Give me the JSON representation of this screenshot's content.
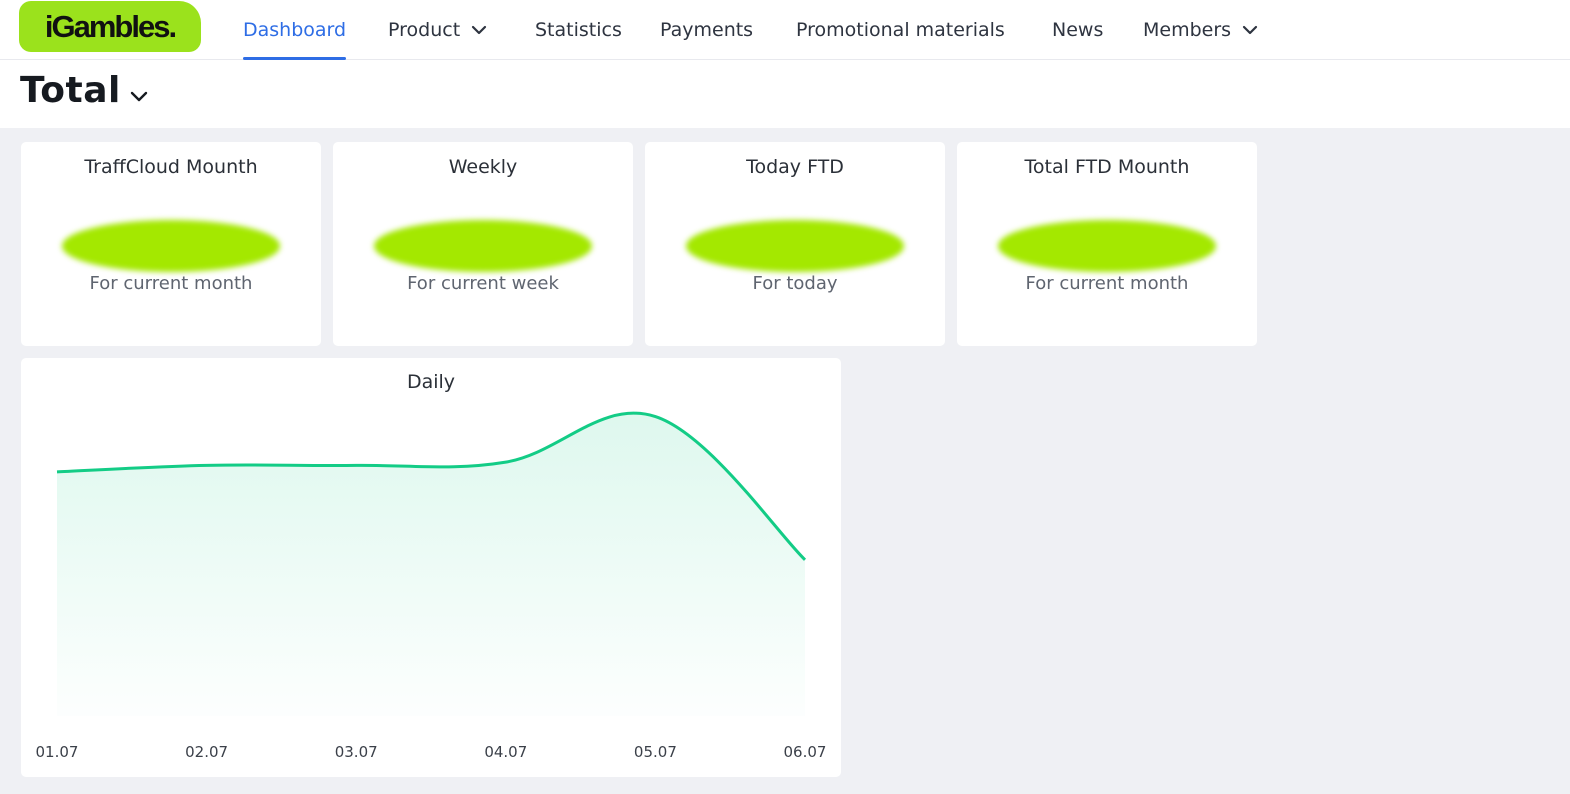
{
  "brand": {
    "logo_text": "iGambles.",
    "accent": "#9be21c",
    "nav_active_color": "#2e6de5"
  },
  "nav": {
    "items": [
      {
        "label": "Dashboard",
        "active": true,
        "has_dropdown": false
      },
      {
        "label": "Product",
        "active": false,
        "has_dropdown": true
      },
      {
        "label": "Statistics",
        "active": false,
        "has_dropdown": false
      },
      {
        "label": "Payments",
        "active": false,
        "has_dropdown": false
      },
      {
        "label": "Promotional materials",
        "active": false,
        "has_dropdown": false
      },
      {
        "label": "News",
        "active": false,
        "has_dropdown": false
      },
      {
        "label": "Members",
        "active": false,
        "has_dropdown": true
      }
    ]
  },
  "page": {
    "title": "Total",
    "title_icon": "chevron-down-icon"
  },
  "kpis": [
    {
      "title": "TraffCloud Mounth",
      "value": "",
      "subtitle": "For current month"
    },
    {
      "title": "Weekly",
      "value": "",
      "subtitle": "For current week"
    },
    {
      "title": "Today FTD",
      "value": "",
      "subtitle": "For today"
    },
    {
      "title": "Total FTD Mounth",
      "value": "",
      "subtitle": "For current month"
    }
  ],
  "daily": {
    "title": "Daily",
    "line_color": "#13cc86",
    "chart_data": {
      "type": "area",
      "title": "Daily",
      "categories": [
        "01.07",
        "02.07",
        "03.07",
        "04.07",
        "05.07",
        "06.07"
      ],
      "values": [
        75,
        77,
        77,
        78,
        92,
        48
      ],
      "ylim": [
        0,
        110
      ],
      "xlabel": "",
      "ylabel": "",
      "grid": false,
      "legend": false
    }
  }
}
